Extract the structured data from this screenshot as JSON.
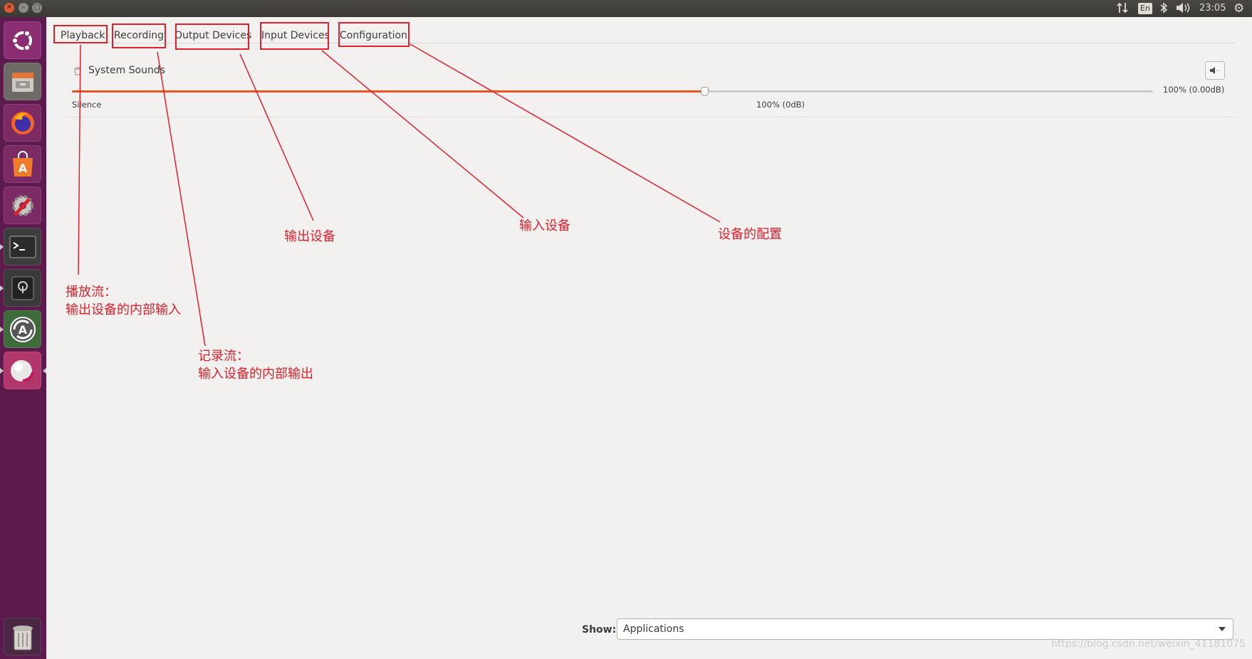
{
  "topbar": {
    "window_buttons": [
      "close",
      "minimize",
      "maximize"
    ],
    "tray": {
      "network_icon": "transfer-arrows-icon",
      "keyboard_layout": "En",
      "bluetooth_icon": "bluetooth-icon",
      "volume_icon": "volume-icon",
      "clock": "23:05",
      "system_icon": "gear-icon"
    }
  },
  "launcher": {
    "items": [
      {
        "name": "ubuntu-dash",
        "icon": "ubuntu-logo-icon"
      },
      {
        "name": "files",
        "icon": "file-cabinet-icon"
      },
      {
        "name": "firefox",
        "icon": "firefox-icon"
      },
      {
        "name": "software-center",
        "icon": "shopping-bag-icon"
      },
      {
        "name": "system-settings",
        "icon": "settings-wrench-icon"
      },
      {
        "name": "terminal",
        "icon": "terminal-icon"
      },
      {
        "name": "keyring",
        "icon": "safe-icon"
      },
      {
        "name": "software-updater",
        "icon": "updater-icon"
      },
      {
        "name": "pavucontrol",
        "icon": "speaker-ball-icon"
      }
    ],
    "trash": {
      "icon": "trash-icon"
    }
  },
  "tabs": [
    "Playback",
    "Recording",
    "Output Devices",
    "Input Devices",
    "Configuration"
  ],
  "stream": {
    "name": "System Sounds",
    "volume_percent": 100,
    "volume_label": "100% (0.00dB)",
    "silence_label": "Silence",
    "marker_label": "100% (0dB)",
    "mute_icon": "speaker-mute-icon"
  },
  "footer": {
    "show_label": "Show:",
    "show_value": "Applications"
  },
  "annotations": {
    "output_devices": "输出设备",
    "input_devices": "输入设备",
    "configuration": "设备的配置",
    "playback": "播放流：\n输出设备的内部输入",
    "recording": "记录流：\n输入设备的内部输出"
  },
  "watermark": "https://blog.csdn.net/weixin_41181075",
  "colors": {
    "annotation": "#e0212b",
    "slider_fill": "#e95420",
    "launcher_bg": "#5d1a4d"
  }
}
